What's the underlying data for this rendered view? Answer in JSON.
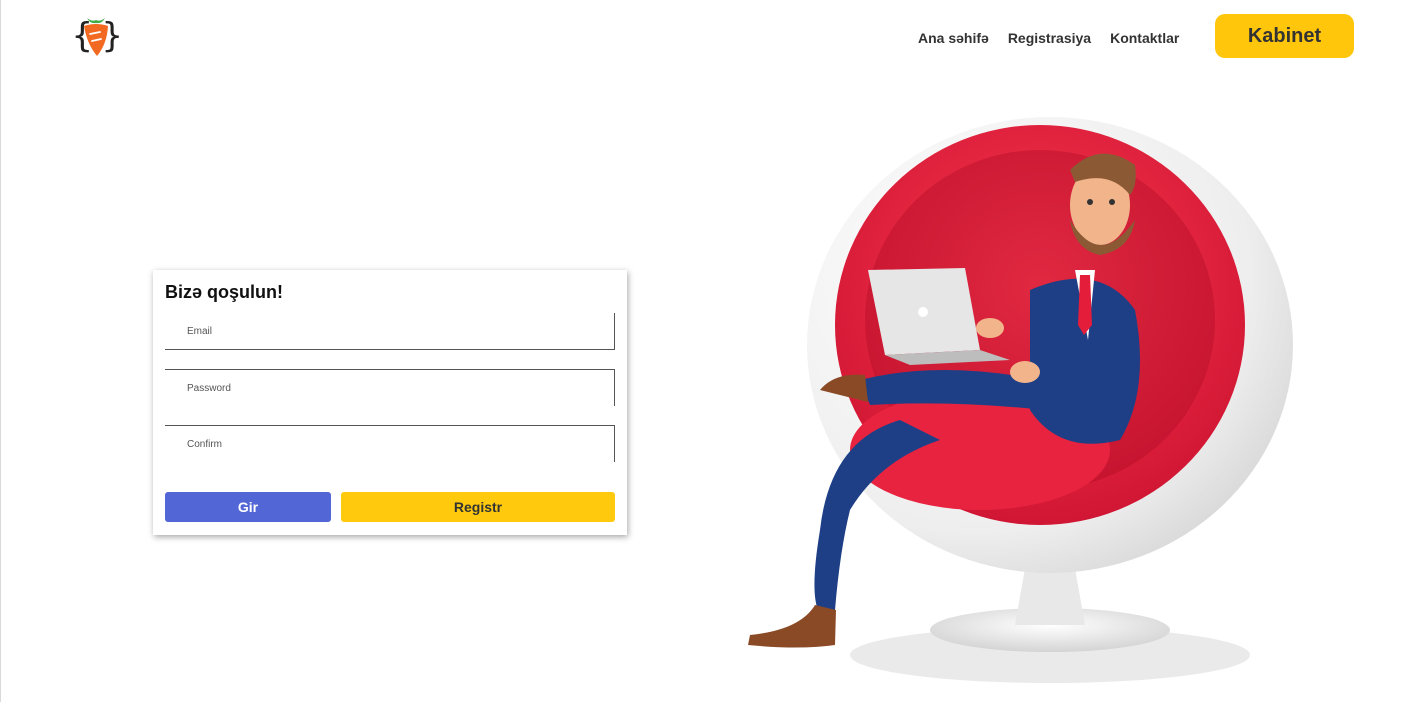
{
  "nav": {
    "items": [
      {
        "label": "Ana səhifə"
      },
      {
        "label": "Registrasiya"
      },
      {
        "label": "Kontaktlar"
      }
    ],
    "cabinet_label": "Kabinet"
  },
  "form": {
    "title": "Bizə qoşulun!",
    "email_placeholder": "Email",
    "password_placeholder": "Password",
    "confirm_placeholder": "Confirm",
    "login_label": "Gir",
    "register_label": "Registr"
  },
  "colors": {
    "accent_yellow": "#ffc60c",
    "button_blue": "#5266d6",
    "chair_red": "#e41d3b",
    "logo_orange": "#f26a21",
    "logo_green": "#3fae49"
  },
  "icons": {
    "logo": "carrot-braces-logo",
    "illustration": "man-in-egg-chair-with-laptop"
  }
}
